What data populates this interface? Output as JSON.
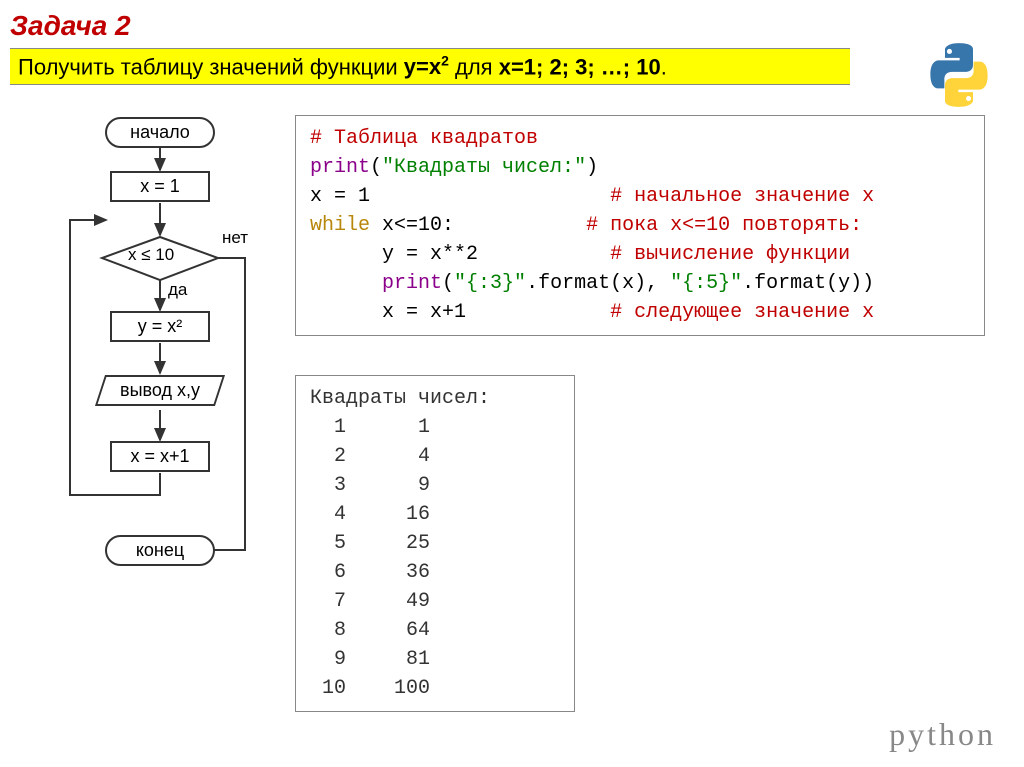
{
  "header": {
    "title": "Задача 2",
    "task_prefix": "Получить таблицу значений функции ",
    "task_func": "y=x",
    "task_exp": "2",
    "task_mid": " для ",
    "task_vals": "x=1; 2; 3; …; 10",
    "task_end": "."
  },
  "flowchart": {
    "start": "начало",
    "init": "x = 1",
    "cond": "x ≤ 10",
    "no": "нет",
    "yes": "да",
    "calc": "y = x²",
    "output": "вывод x,y",
    "inc": "x = x+1",
    "end": "конец"
  },
  "code": {
    "l1": "# Таблица квадратов",
    "l2a": "print",
    "l2b": "(",
    "l2c": "\"Квадраты чисел:\"",
    "l2d": ")",
    "l3a": "x = 1                    ",
    "l3b": "# начальное значение x",
    "l4a": "while",
    "l4b": " x<=10:           ",
    "l4c": "# пока x<=10 повторять:",
    "l5a": "      y = x**2           ",
    "l5b": "# вычисление функции",
    "l6a": "      ",
    "l6b": "print",
    "l6c": "(",
    "l6d": "\"{:3}\"",
    "l6e": ".format(x), ",
    "l6f": "\"{:5}\"",
    "l6g": ".format(y))",
    "l7a": "      x = x+1            ",
    "l7b": "# следующее значение x"
  },
  "output": {
    "header": "Квадраты чисел:",
    "rows": [
      {
        "x": "  1",
        "y": "    1"
      },
      {
        "x": "  2",
        "y": "    4"
      },
      {
        "x": "  3",
        "y": "    9"
      },
      {
        "x": "  4",
        "y": "   16"
      },
      {
        "x": "  5",
        "y": "   25"
      },
      {
        "x": "  6",
        "y": "   36"
      },
      {
        "x": "  7",
        "y": "   49"
      },
      {
        "x": "  8",
        "y": "   64"
      },
      {
        "x": "  9",
        "y": "   81"
      },
      {
        "x": " 10",
        "y": "  100"
      }
    ]
  },
  "footer": {
    "python": "python"
  }
}
